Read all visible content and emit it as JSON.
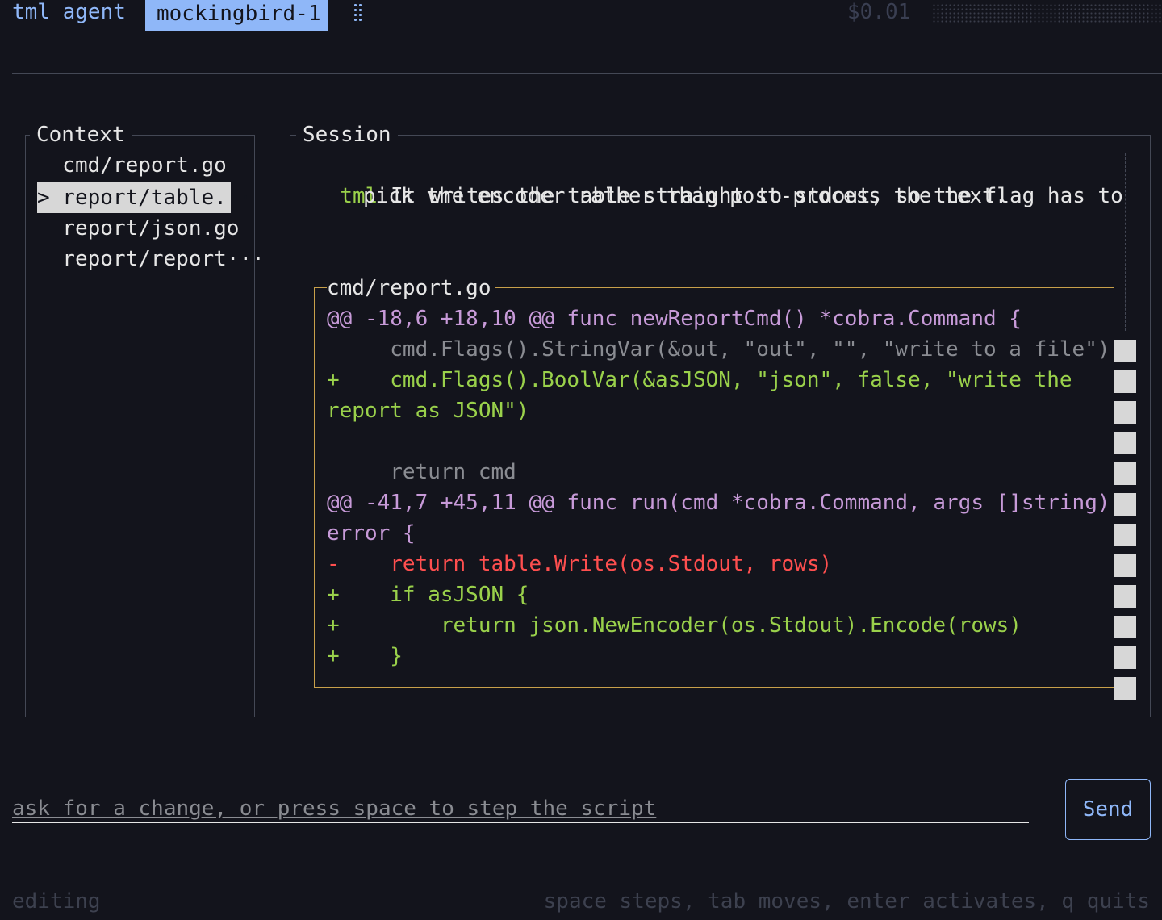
{
  "header": {
    "brand": "tml agent",
    "active_tab": "mockingbird-1",
    "cost": "$0.01"
  },
  "context": {
    "title": "Context",
    "items": [
      {
        "label": "  cmd/report.go",
        "selected": false
      },
      {
        "label": "> report/table.··",
        "selected": true
      },
      {
        "label": "  report/json.go",
        "selected": false
      },
      {
        "label": "  report/report···",
        "selected": false
      }
    ]
  },
  "session": {
    "title": "Session",
    "speaker": "tml",
    "message_lines": [
      "It writes the table straight to stdout, so the flag has to",
      "pick the encoder rather than post-process the text."
    ],
    "diff": {
      "file": "cmd/report.go",
      "lines": [
        {
          "kind": "hunk",
          "text": "@@ -18,6 +18,10 @@ func newReportCmd() *cobra.Command {"
        },
        {
          "kind": "ctx",
          "text": "     cmd.Flags().StringVar(&out, \"out\", \"\", \"write to a file\")"
        },
        {
          "kind": "add",
          "text": "+    cmd.Flags().BoolVar(&asJSON, \"json\", false, \"write the"
        },
        {
          "kind": "add",
          "text": "report as JSON\")"
        },
        {
          "kind": "ctx",
          "text": ""
        },
        {
          "kind": "ctx",
          "text": "     return cmd"
        },
        {
          "kind": "hunk",
          "text": "@@ -41,7 +45,11 @@ func run(cmd *cobra.Command, args []string)"
        },
        {
          "kind": "hunk",
          "text": "error {"
        },
        {
          "kind": "del",
          "text": "-    return table.Write(os.Stdout, rows)"
        },
        {
          "kind": "add",
          "text": "+    if asJSON {"
        },
        {
          "kind": "add",
          "text": "+        return json.NewEncoder(os.Stdout).Encode(rows)"
        },
        {
          "kind": "add",
          "text": "+    }"
        }
      ]
    }
  },
  "input": {
    "placeholder": "ask for a change, or press space to step the script",
    "send_label": "Send"
  },
  "status": {
    "mode": "editing",
    "hints": "space steps, tab moves, enter activates, q quits"
  },
  "colors": {
    "background": "#13141c",
    "accent": "#8fb7f8",
    "add": "#9ad14b",
    "delete": "#ff4f4f",
    "hunk": "#c79ad8",
    "diff_border": "#c8a04a"
  }
}
